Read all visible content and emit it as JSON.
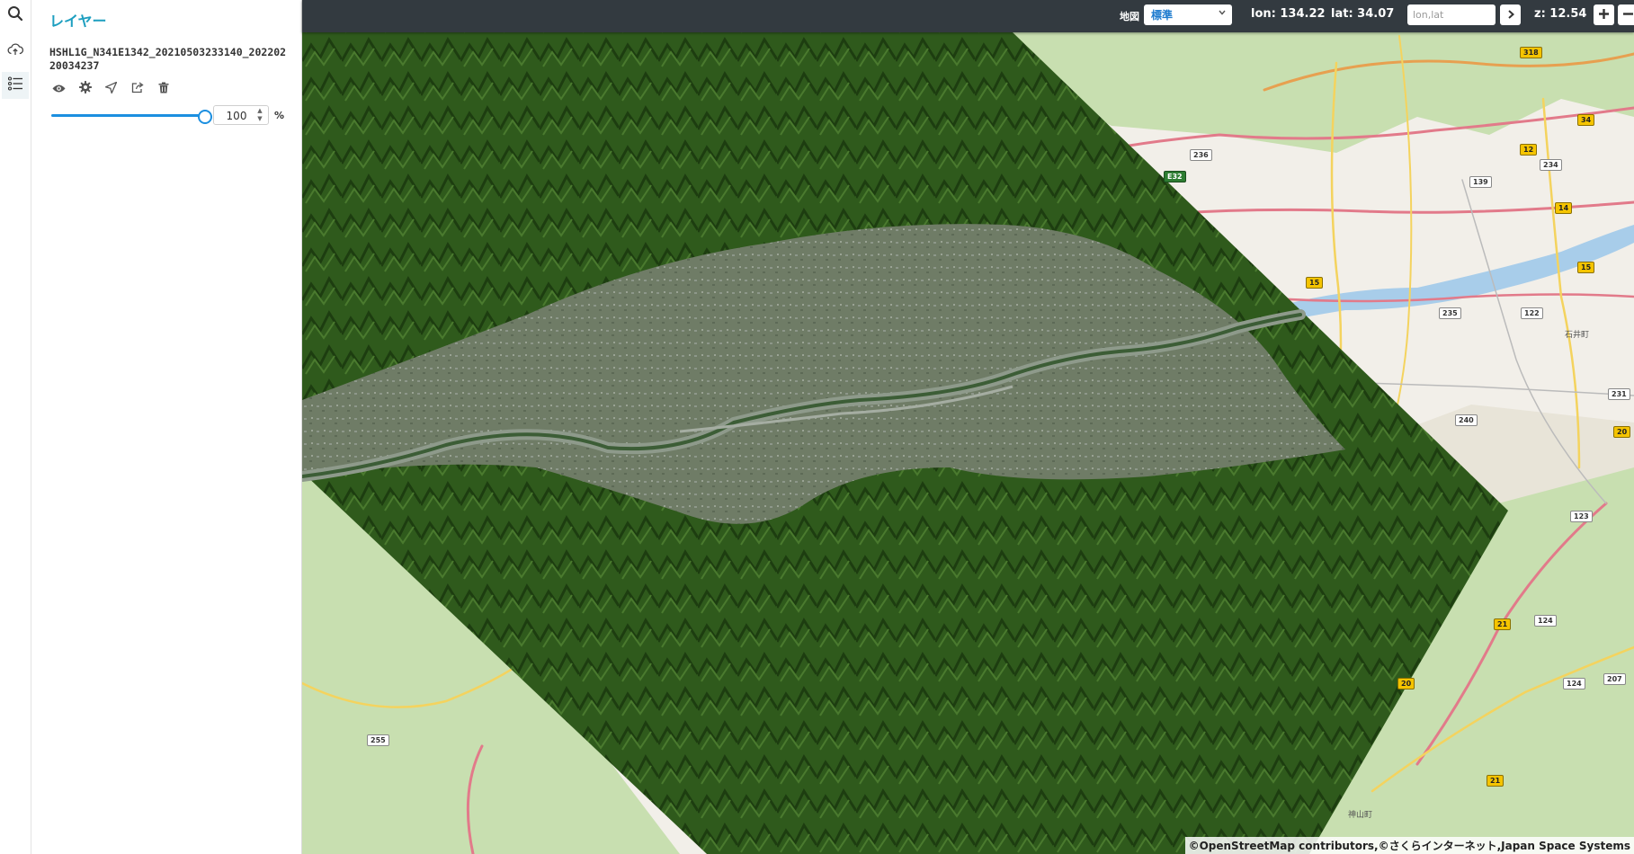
{
  "rail": {
    "items": [
      {
        "name": "search-icon"
      },
      {
        "name": "cloud-upload-icon"
      },
      {
        "name": "layer-list-icon"
      }
    ]
  },
  "panel": {
    "title": "レイヤー",
    "layer": {
      "name": "HSHL1G_N341E1342_20210503233140_20220220034237",
      "opacity": 100,
      "opacity_unit": "%",
      "tools": [
        "eye-icon",
        "gear-icon",
        "locate-arrow-icon",
        "share-icon",
        "trash-icon"
      ]
    }
  },
  "topbar": {
    "map_label": "地図",
    "map_select_value": "標準",
    "lon_text": "lon: 134.22",
    "lat_text": "lat: 34.07",
    "coord_placeholder": "lon,lat",
    "zoom_text": "z: 12.54"
  },
  "map": {
    "shields": [
      {
        "text": "318",
        "type": "y"
      },
      {
        "text": "236",
        "type": "w"
      },
      {
        "text": "E32",
        "type": "g"
      },
      {
        "text": "139",
        "type": "w"
      },
      {
        "text": "12",
        "type": "y"
      },
      {
        "text": "234",
        "type": "w"
      },
      {
        "text": "34",
        "type": "y"
      },
      {
        "text": "14",
        "type": "y"
      },
      {
        "text": "15",
        "type": "y"
      },
      {
        "text": "15",
        "type": "y"
      },
      {
        "text": "235",
        "type": "w"
      },
      {
        "text": "122",
        "type": "w"
      },
      {
        "text": "240",
        "type": "w"
      },
      {
        "text": "231",
        "type": "w"
      },
      {
        "text": "20",
        "type": "y"
      },
      {
        "text": "123",
        "type": "w"
      },
      {
        "text": "21",
        "type": "y"
      },
      {
        "text": "124",
        "type": "w"
      },
      {
        "text": "20",
        "type": "y"
      },
      {
        "text": "124",
        "type": "w"
      },
      {
        "text": "207",
        "type": "w"
      },
      {
        "text": "21",
        "type": "y"
      },
      {
        "text": "255",
        "type": "w"
      }
    ],
    "places": [
      "石井町",
      "神山町"
    ],
    "attribution": "©OpenStreetMap contributors,©さくらインターネット,Japan Space Systems"
  }
}
